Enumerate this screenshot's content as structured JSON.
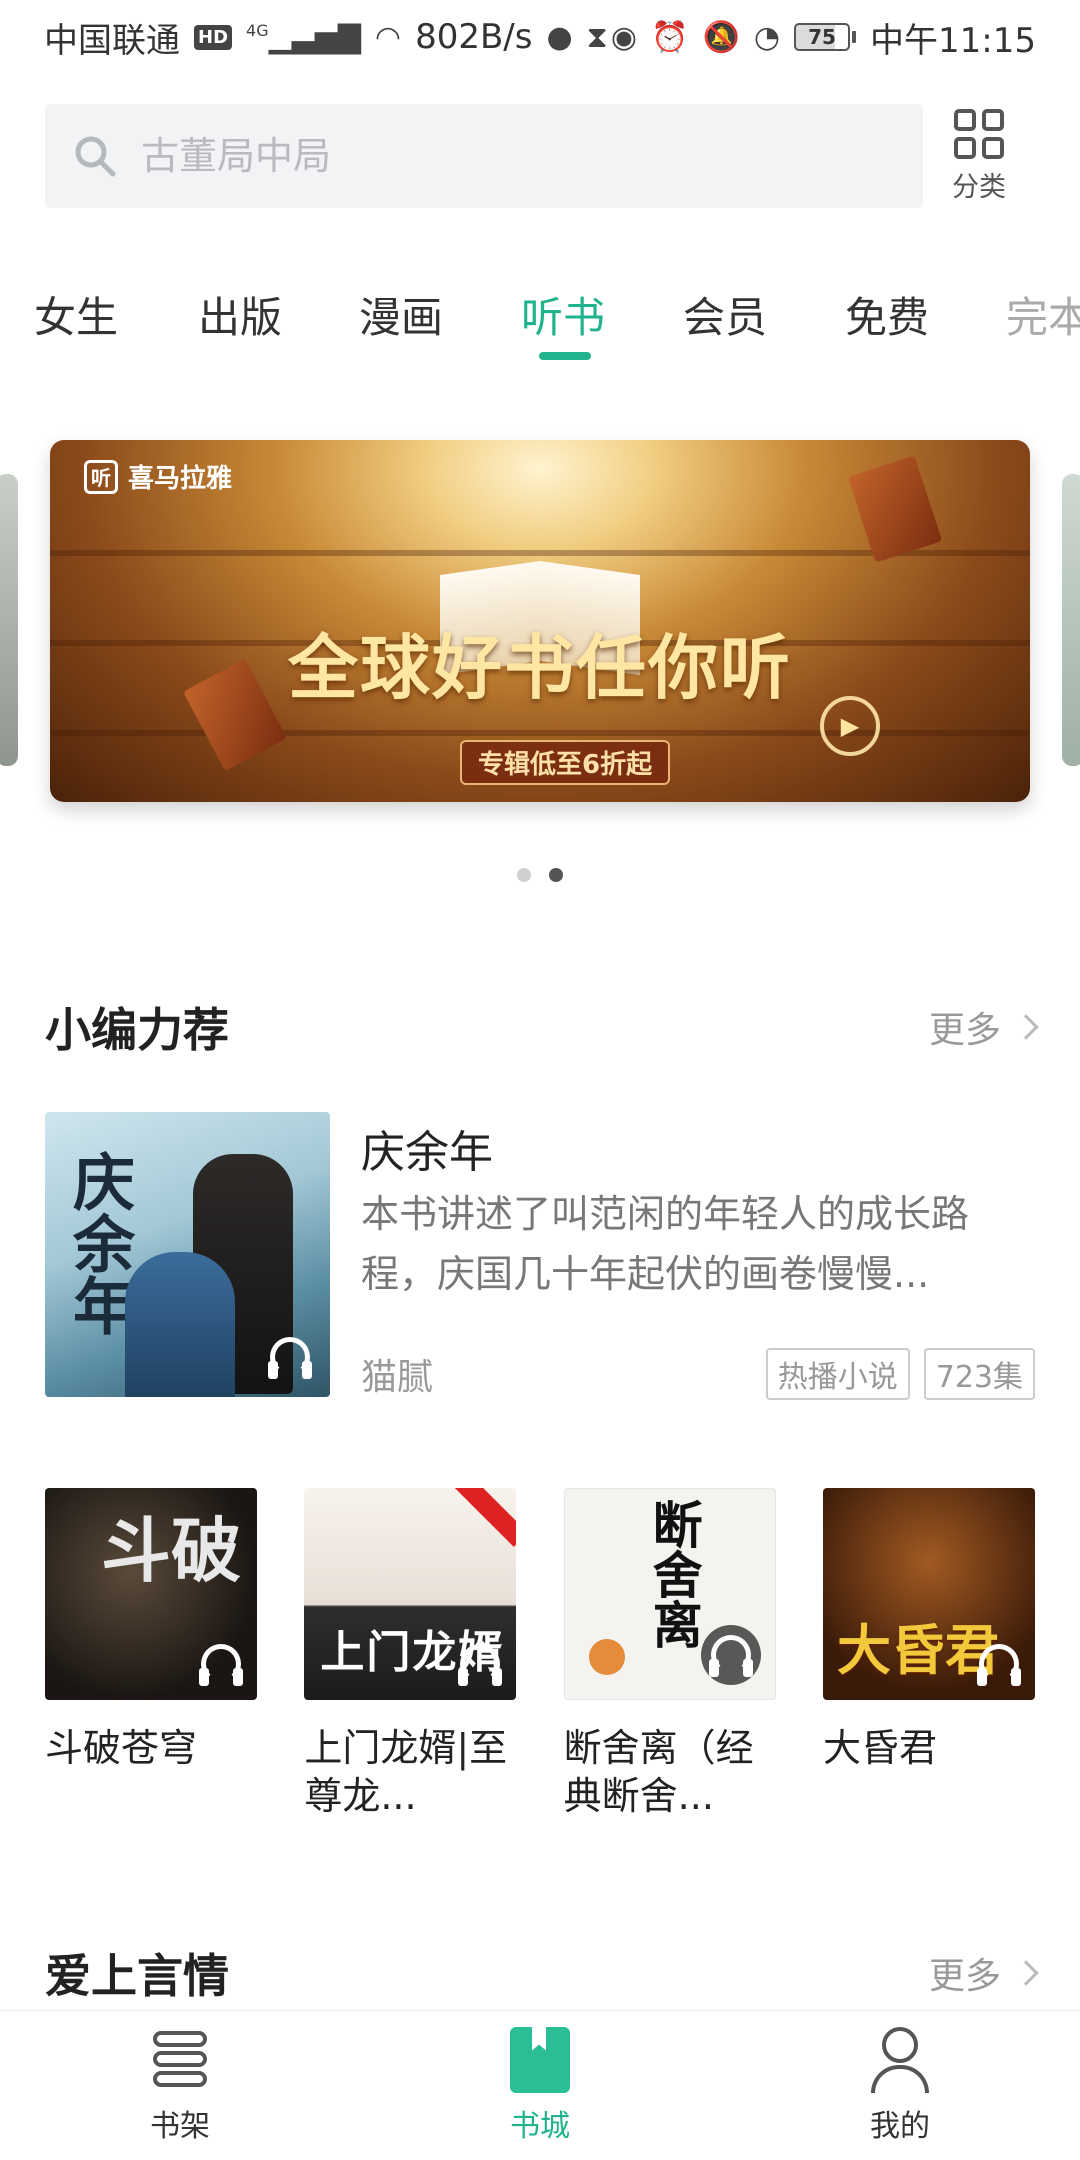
{
  "status_bar": {
    "carrier": "中国联通",
    "hd": "HD",
    "network": "4G",
    "speed": "802B/s",
    "battery": "75",
    "time": "中午11:15"
  },
  "search": {
    "placeholder": "古董局中局",
    "category_label": "分类"
  },
  "tabs": [
    {
      "label": "女生",
      "active": false
    },
    {
      "label": "出版",
      "active": false
    },
    {
      "label": "漫画",
      "active": false
    },
    {
      "label": "听书",
      "active": true
    },
    {
      "label": "会员",
      "active": false
    },
    {
      "label": "免费",
      "active": false
    },
    {
      "label": "完本",
      "active": false
    }
  ],
  "banner": {
    "brand": "喜马拉雅",
    "logo_char": "听",
    "headline": "全球好书任你听",
    "subline": "专辑低至6折起",
    "page_count": 2,
    "active_page": 2
  },
  "section1": {
    "title": "小编力荐",
    "more": "更多"
  },
  "featured": {
    "title": "庆余年",
    "description": "本书讲述了叫范闲的年轻人的成长路程，庆国几十年起伏的画卷慢慢...",
    "author": "猫腻",
    "tags": [
      "热播小说",
      "723集"
    ],
    "cover_text": "庆余年"
  },
  "books": [
    {
      "name": "斗破苍穹",
      "cover_text": "斗破"
    },
    {
      "name": "上门龙婿|至尊龙...",
      "cover_text": "上门龙婿"
    },
    {
      "name": "断舍离（经典断舍...",
      "cover_text": "断舍离"
    },
    {
      "name": "大昏君",
      "cover_text": "大昏君"
    }
  ],
  "section2": {
    "title": "爱上言情",
    "more": "更多"
  },
  "bottom_nav": [
    {
      "label": "书架",
      "active": false
    },
    {
      "label": "书城",
      "active": true
    },
    {
      "label": "我的",
      "active": false
    }
  ],
  "colors": {
    "accent": "#21b28e",
    "text_primary": "#222222",
    "text_secondary": "#999999"
  }
}
